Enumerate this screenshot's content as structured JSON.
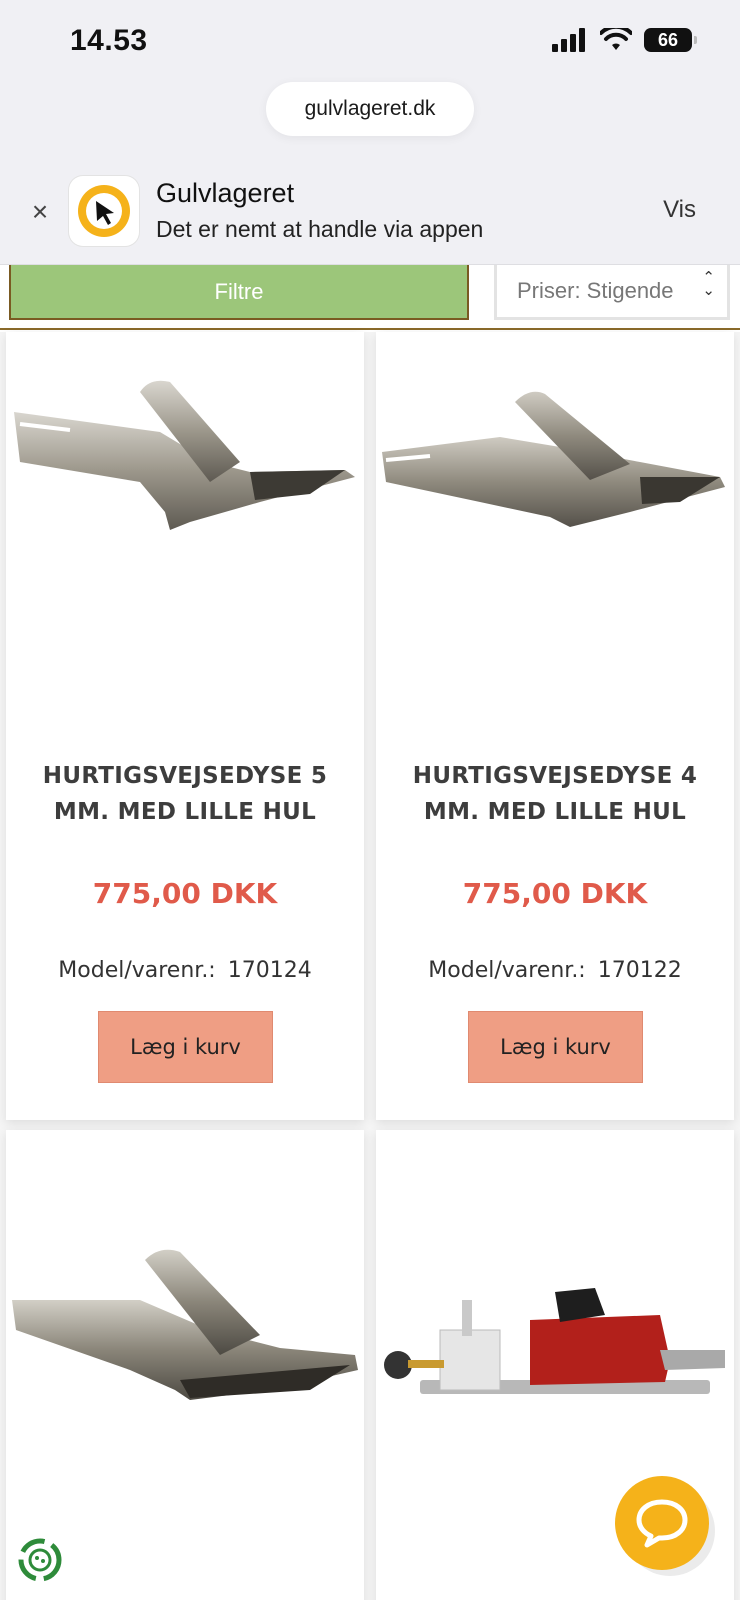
{
  "status_bar": {
    "time": "14.53",
    "battery": "66"
  },
  "browser": {
    "url": "gulvlageret.dk"
  },
  "app_banner": {
    "close": "×",
    "title": "Gulvlageret",
    "subtitle": "Det er nemt at handle via appen",
    "view_label": "Vis"
  },
  "filters": {
    "filter_label": "Filtre",
    "sort_value": "Priser: Stigende"
  },
  "products": [
    {
      "title": "HURTIGSVEJSEDYSE 5 MM. MED LILLE HUL",
      "price": "775,00 DKK",
      "model_label": "Model/varenr.:",
      "model_no": "170124",
      "cart_label": "Læg i kurv"
    },
    {
      "title": "HURTIGSVEJSEDYSE 4 MM. MED LILLE HUL",
      "price": "775,00 DKK",
      "model_label": "Model/varenr.:",
      "model_no": "170122",
      "cart_label": "Læg i kurv"
    }
  ],
  "colors": {
    "filter_green": "#9cc67a",
    "price_red": "#e05a4a",
    "cart_salmon": "#ef9e84",
    "brand_yellow": "#f5b21a"
  }
}
